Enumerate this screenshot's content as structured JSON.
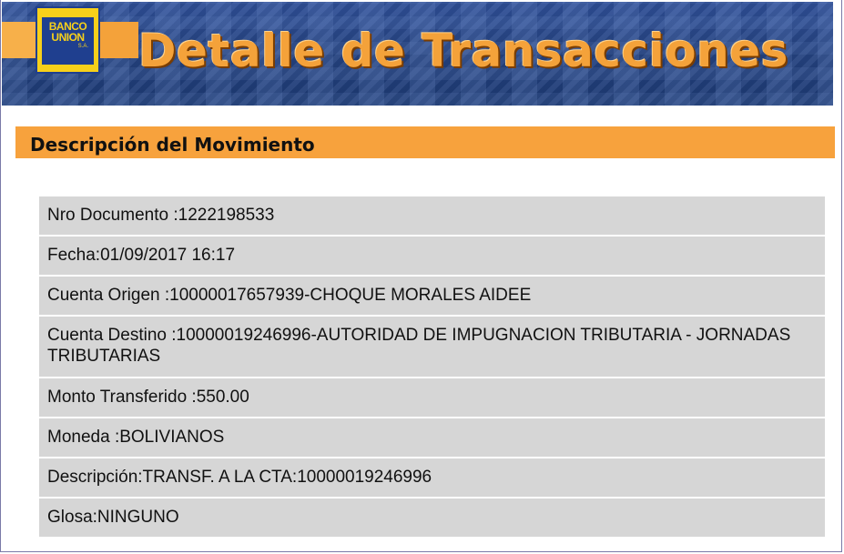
{
  "banner": {
    "logo_line1": "BANCO",
    "logo_line2": "UNION",
    "logo_suffix": "S.A.",
    "title": "Detalle de Transacciones"
  },
  "section": {
    "title": "Descripción del Movimiento"
  },
  "details": [
    {
      "label": "Nro Documento :",
      "value": "1222198533"
    },
    {
      "label": "Fecha:",
      "value": "01/09/2017 16:17"
    },
    {
      "label": "Cuenta Origen :",
      "value": "10000017657939-CHOQUE MORALES AIDEE"
    },
    {
      "label": "Cuenta Destino :",
      "value": "10000019246996-AUTORIDAD DE IMPUGNACION TRIBUTARIA - JORNADAS TRIBUTARIAS"
    },
    {
      "label": "Monto Transferido :",
      "value": "550.00"
    },
    {
      "label": "Moneda :",
      "value": "BOLIVIANOS"
    },
    {
      "label": "Descripción:",
      "value": "TRANSF. A LA CTA:10000019246996"
    },
    {
      "label": "Glosa:",
      "value": "NINGUNO"
    }
  ],
  "colors": {
    "banner_blue": "#24427f",
    "accent_orange": "#f7a23d",
    "logo_yellow": "#f7d01a",
    "row_gray": "#d6d6d6"
  }
}
